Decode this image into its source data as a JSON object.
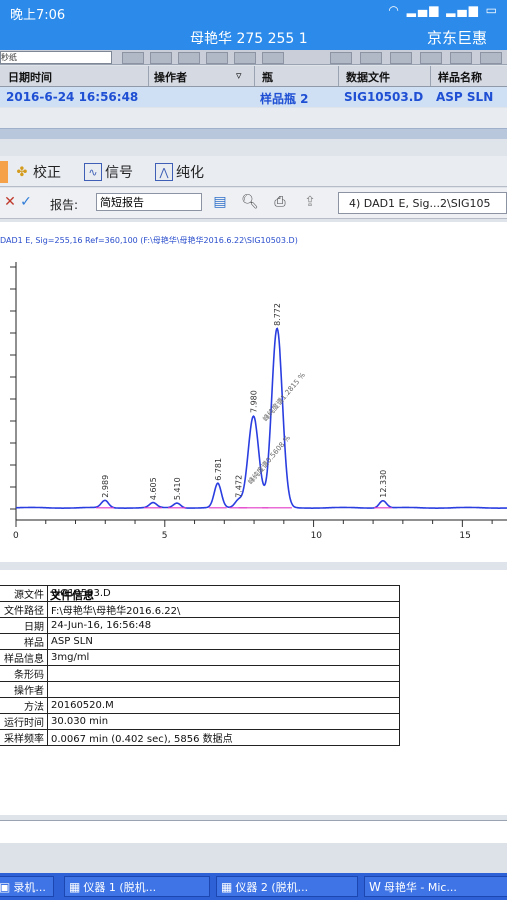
{
  "phone": {
    "time": "晚上7:06",
    "chat_title": "母艳华  275  255 1",
    "right_label": "京东巨惠"
  },
  "top_strip": {
    "input_text": "秒纸"
  },
  "samples": {
    "headers": [
      "日期时间",
      "操作者",
      "瓶",
      "数据文件",
      "样品名称"
    ],
    "row": [
      "2016-6-24 16:56:48",
      "",
      "样品瓶 2",
      "SIG10503.D",
      "ASP SLN"
    ]
  },
  "tabs": [
    {
      "icon": "calibrate-icon",
      "label": "校正"
    },
    {
      "icon": "signal-icon",
      "label": "信号"
    },
    {
      "icon": "purity-icon",
      "label": "纯化"
    }
  ],
  "report": {
    "label": "报告:",
    "selected": "简短报告",
    "signal_value": "4) DAD1 E, Sig...2\\SIG105"
  },
  "chart_data": {
    "type": "line",
    "subtitle": "DAD1 E, Sig=255,16 Ref=360,100 (F:\\母艳华\\母艳华2016.6.22\\SIG10503.D)",
    "xlim": [
      0,
      16.5
    ],
    "ylim": [
      0,
      100
    ],
    "x_ticks": [
      "0",
      "5",
      "10",
      "15"
    ],
    "peaks": [
      {
        "rt": 2.989,
        "label": "2.989",
        "height": 3
      },
      {
        "rt": 4.605,
        "label": "4.605",
        "height": 2
      },
      {
        "rt": 5.41,
        "label": "5.410",
        "height": 2
      },
      {
        "rt": 6.781,
        "label": "6.781",
        "height": 10
      },
      {
        "rt": 7.472,
        "label": "7.472",
        "height": 3
      },
      {
        "rt": 7.98,
        "label": "7.980",
        "height": 38
      },
      {
        "rt": 8.772,
        "label": "8.772",
        "height": 74
      },
      {
        "rt": 12.33,
        "label": "12.330",
        "height": 3
      }
    ],
    "annotations": [
      "峰纯度谱1.2815 %",
      "峰纯度谱0.5608 %"
    ]
  },
  "info": {
    "title": "文件信息",
    "rows": [
      {
        "k": "源文件",
        "v": "SIG10503.D"
      },
      {
        "k": "文件路径",
        "v": "F:\\母艳华\\母艳华2016.6.22\\"
      },
      {
        "k": "日期",
        "v": "24-Jun-16, 16:56:48"
      },
      {
        "k": "样品",
        "v": "ASP SLN"
      },
      {
        "k": "样品信息",
        "v": "3mg/ml"
      },
      {
        "k": "条形码",
        "v": ""
      },
      {
        "k": "操作者",
        "v": ""
      },
      {
        "k": "方法",
        "v": "20160520.M"
      },
      {
        "k": "运行时间",
        "v": "30.030 min"
      },
      {
        "k": "采样频率",
        "v": "0.0067 min (0.402 sec), 5856 数据点"
      }
    ]
  },
  "taskbar": [
    {
      "icon": "app-icon",
      "label": "录机..."
    },
    {
      "icon": "instrument-icon",
      "label": "仪器 1 (脱机..."
    },
    {
      "icon": "instrument-icon",
      "label": "仪器 2 (脱机..."
    },
    {
      "icon": "word-icon",
      "label": "母艳华 - Mic..."
    }
  ],
  "colors": {
    "phone_header": "#2c8bea",
    "signal_line": "#2a3ee0",
    "baseline": "#e23bc8",
    "taskbar": "#2f61d6"
  }
}
